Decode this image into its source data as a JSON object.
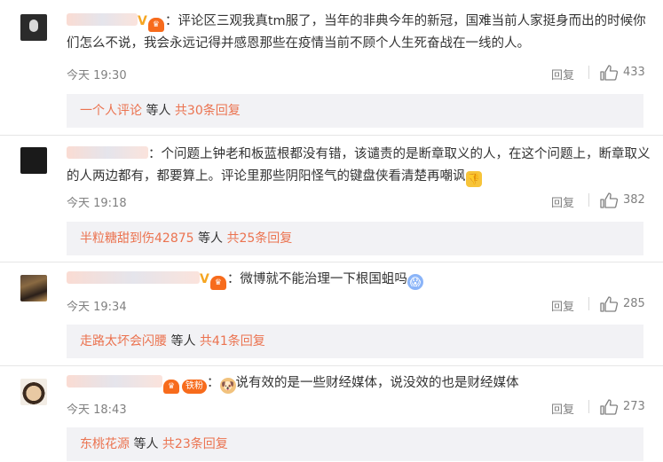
{
  "comments": [
    {
      "username_suffix": "V",
      "sep": "：",
      "text": "评论区三观我真tm服了，当年的非典今年的新冠，国难当前人家挺身而出的时候你们怎么不说，我会永远记得并感恩那些在疫情当前不顾个人生死奋战在一线的人。",
      "time": "今天 19:30",
      "reply_label": "回复",
      "likes": "433",
      "sub_user": "一个人评论",
      "sub_mid": " 等人 ",
      "sub_count": "共30条回复"
    },
    {
      "sep": "：",
      "text": "个问题上钟老和板蓝根都没有错，该谴责的是断章取义的人，在这个问题上，断章取义的人两边都有，都要算上。评论里那些阴阳怪气的键盘侠看清楚再嘲讽",
      "time": "今天 19:18",
      "reply_label": "回复",
      "likes": "382",
      "sub_user": "半粒糖甜到伤42875",
      "sub_mid": " 等人 ",
      "sub_count": "共25条回复"
    },
    {
      "sep": "：",
      "text": "微博就不能治理一下根国蛆吗",
      "time": "今天 19:34",
      "reply_label": "回复",
      "likes": "285",
      "sub_user": "走路太坏会闪腰",
      "sub_mid": " 等人 ",
      "sub_count": "共41条回复"
    },
    {
      "fan_label": "铁粉",
      "sep": "：",
      "text": "说有效的是一些财经媒体，说没效的也是财经媒体",
      "time": "今天 18:43",
      "reply_label": "回复",
      "likes": "273",
      "sub_user": "东桃花源",
      "sub_mid": " 等人 ",
      "sub_count": "共23条回复"
    }
  ],
  "colors": {
    "accent": "#eb7350",
    "meta": "#808080",
    "subbox_bg": "#f2f2f5"
  }
}
